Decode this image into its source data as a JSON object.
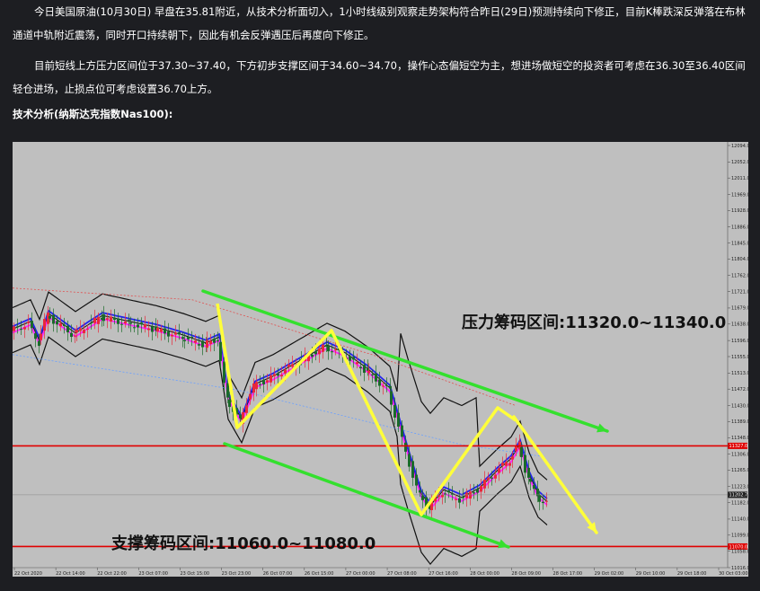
{
  "article": {
    "paragraph1": "今日美国原油(10月30日) 早盘在35.81附近，从技术分析面切入，1小时线级别观察走势架构符合昨日(29日)预测持续向下修正，目前K棒跌深反弹落在布林通道中轨附近震荡，同时开口持续朝下，因此有机会反弹遇压后再度向下修正。",
    "paragraph2": "目前短线上方压力区间位于37.30~37.40，下方初步支撑区间于34.60~34.70，操作心态偏短空为主，想进场做短空的投资者可考虑在36.30至36.40区间轻仓进场，止损点位可考虑设置36.70上方。",
    "heading": "技术分析(纳斯达克指数Nas100):"
  },
  "chart_data": {
    "type": "candlestick",
    "instrument": "纳斯达克指数Nas100",
    "annotations": {
      "resistance": "压力筹码区间:11320.0~11340.0",
      "support": "支撑筹码区间:11060.0~11080.0"
    },
    "y_ticks": [
      "12094.0",
      "12052.0",
      "12011.0",
      "11969.0",
      "11928.0",
      "11886.0",
      "11845.0",
      "11804.0",
      "11762.0",
      "11721.0",
      "11679.0",
      "11638.0",
      "11596.0",
      "11555.0",
      "11513.0",
      "11472.0",
      "11430.0",
      "11389.0",
      "11348.0",
      "11306.0",
      "11265.0",
      "11223.0",
      "11182.0",
      "11140.0",
      "11099.0",
      "11058.0",
      "11016.0"
    ],
    "x_ticks": [
      "22 Oct 2020",
      "22 Oct 14:00",
      "22 Oct 22:00",
      "23 Oct 07:00",
      "23 Oct 15:00",
      "23 Oct 23:00",
      "26 Oct 07:00",
      "26 Oct 15:00",
      "27 Oct 00:00",
      "27 Oct 08:00",
      "27 Oct 16:00",
      "28 Oct 00:00",
      "28 Oct 09:00",
      "28 Oct 17:00",
      "29 Oct 02:00",
      "29 Oct 10:00",
      "29 Oct 18:00",
      "30 Oct 03:00"
    ],
    "ylim": [
      11016.0,
      12094.0
    ],
    "horizontal_lines": [
      {
        "value": 11327.0,
        "label": "11327.0",
        "color": "#e00000"
      },
      {
        "value": 11070.0,
        "label": "11070.0",
        "color": "#e00000"
      }
    ],
    "current_price": {
      "value": 11202.0,
      "label": "11202.7"
    },
    "colors": {
      "up": "#e8283a",
      "down": "#1a6a2a",
      "arrow_green": "#34e02e",
      "arrow_yellow": "#ffff3a",
      "ma_blue": "#2222ee",
      "ma_magenta": "#ff22ff",
      "band": "#111111"
    }
  }
}
